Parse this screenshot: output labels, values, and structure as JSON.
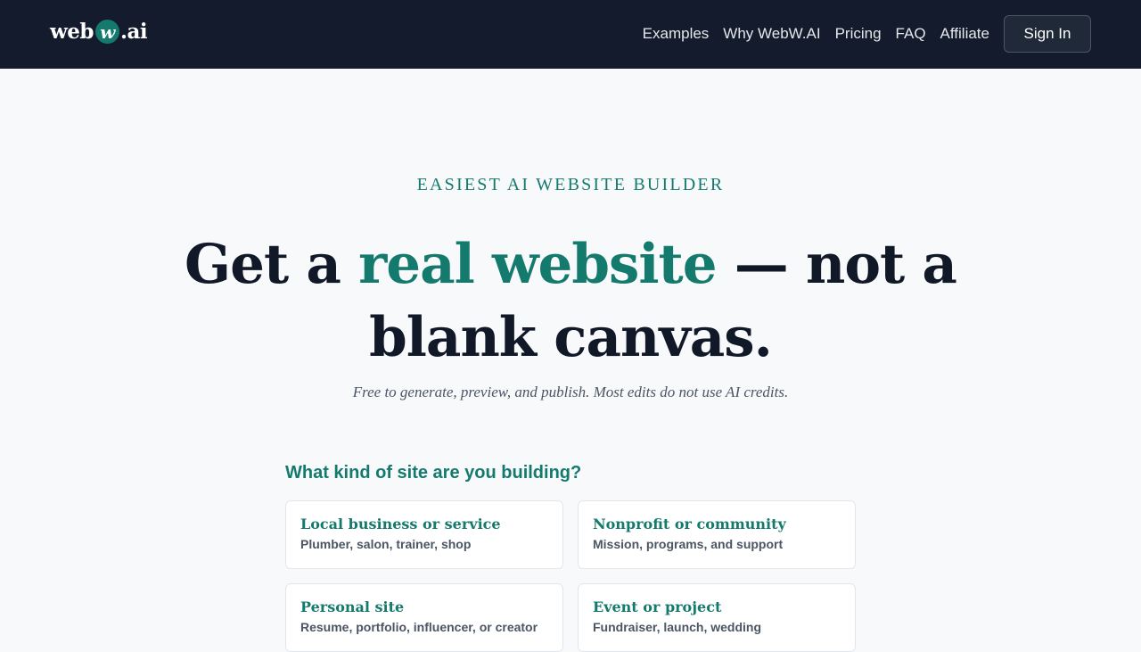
{
  "header": {
    "logo": {
      "prefix": "web",
      "mark": "w",
      "suffix": ".ai"
    },
    "nav": [
      "Examples",
      "Why WebW.AI",
      "Pricing",
      "FAQ",
      "Affiliate"
    ],
    "signin_label": "Sign In"
  },
  "hero": {
    "eyebrow": "EASIEST AI WEBSITE BUILDER",
    "headline_pre": "Get a ",
    "headline_accent": "real website",
    "headline_post": " — not a blank canvas.",
    "subline": "Free to generate, preview, and publish. Most edits do not use AI credits."
  },
  "chooser": {
    "question": "What kind of site are you building?",
    "options": [
      {
        "title": "Local business or service",
        "desc": "Plumber, salon, trainer, shop"
      },
      {
        "title": "Nonprofit or community",
        "desc": "Mission, programs, and support"
      },
      {
        "title": "Personal site",
        "desc": "Resume, portfolio, influencer, or creator"
      },
      {
        "title": "Event or project",
        "desc": "Fundraiser, launch, wedding"
      }
    ]
  },
  "colors": {
    "header_bg": "#131b2c",
    "accent": "#157a6e",
    "page_bg": "#f7f9fb",
    "text": "#111827"
  }
}
